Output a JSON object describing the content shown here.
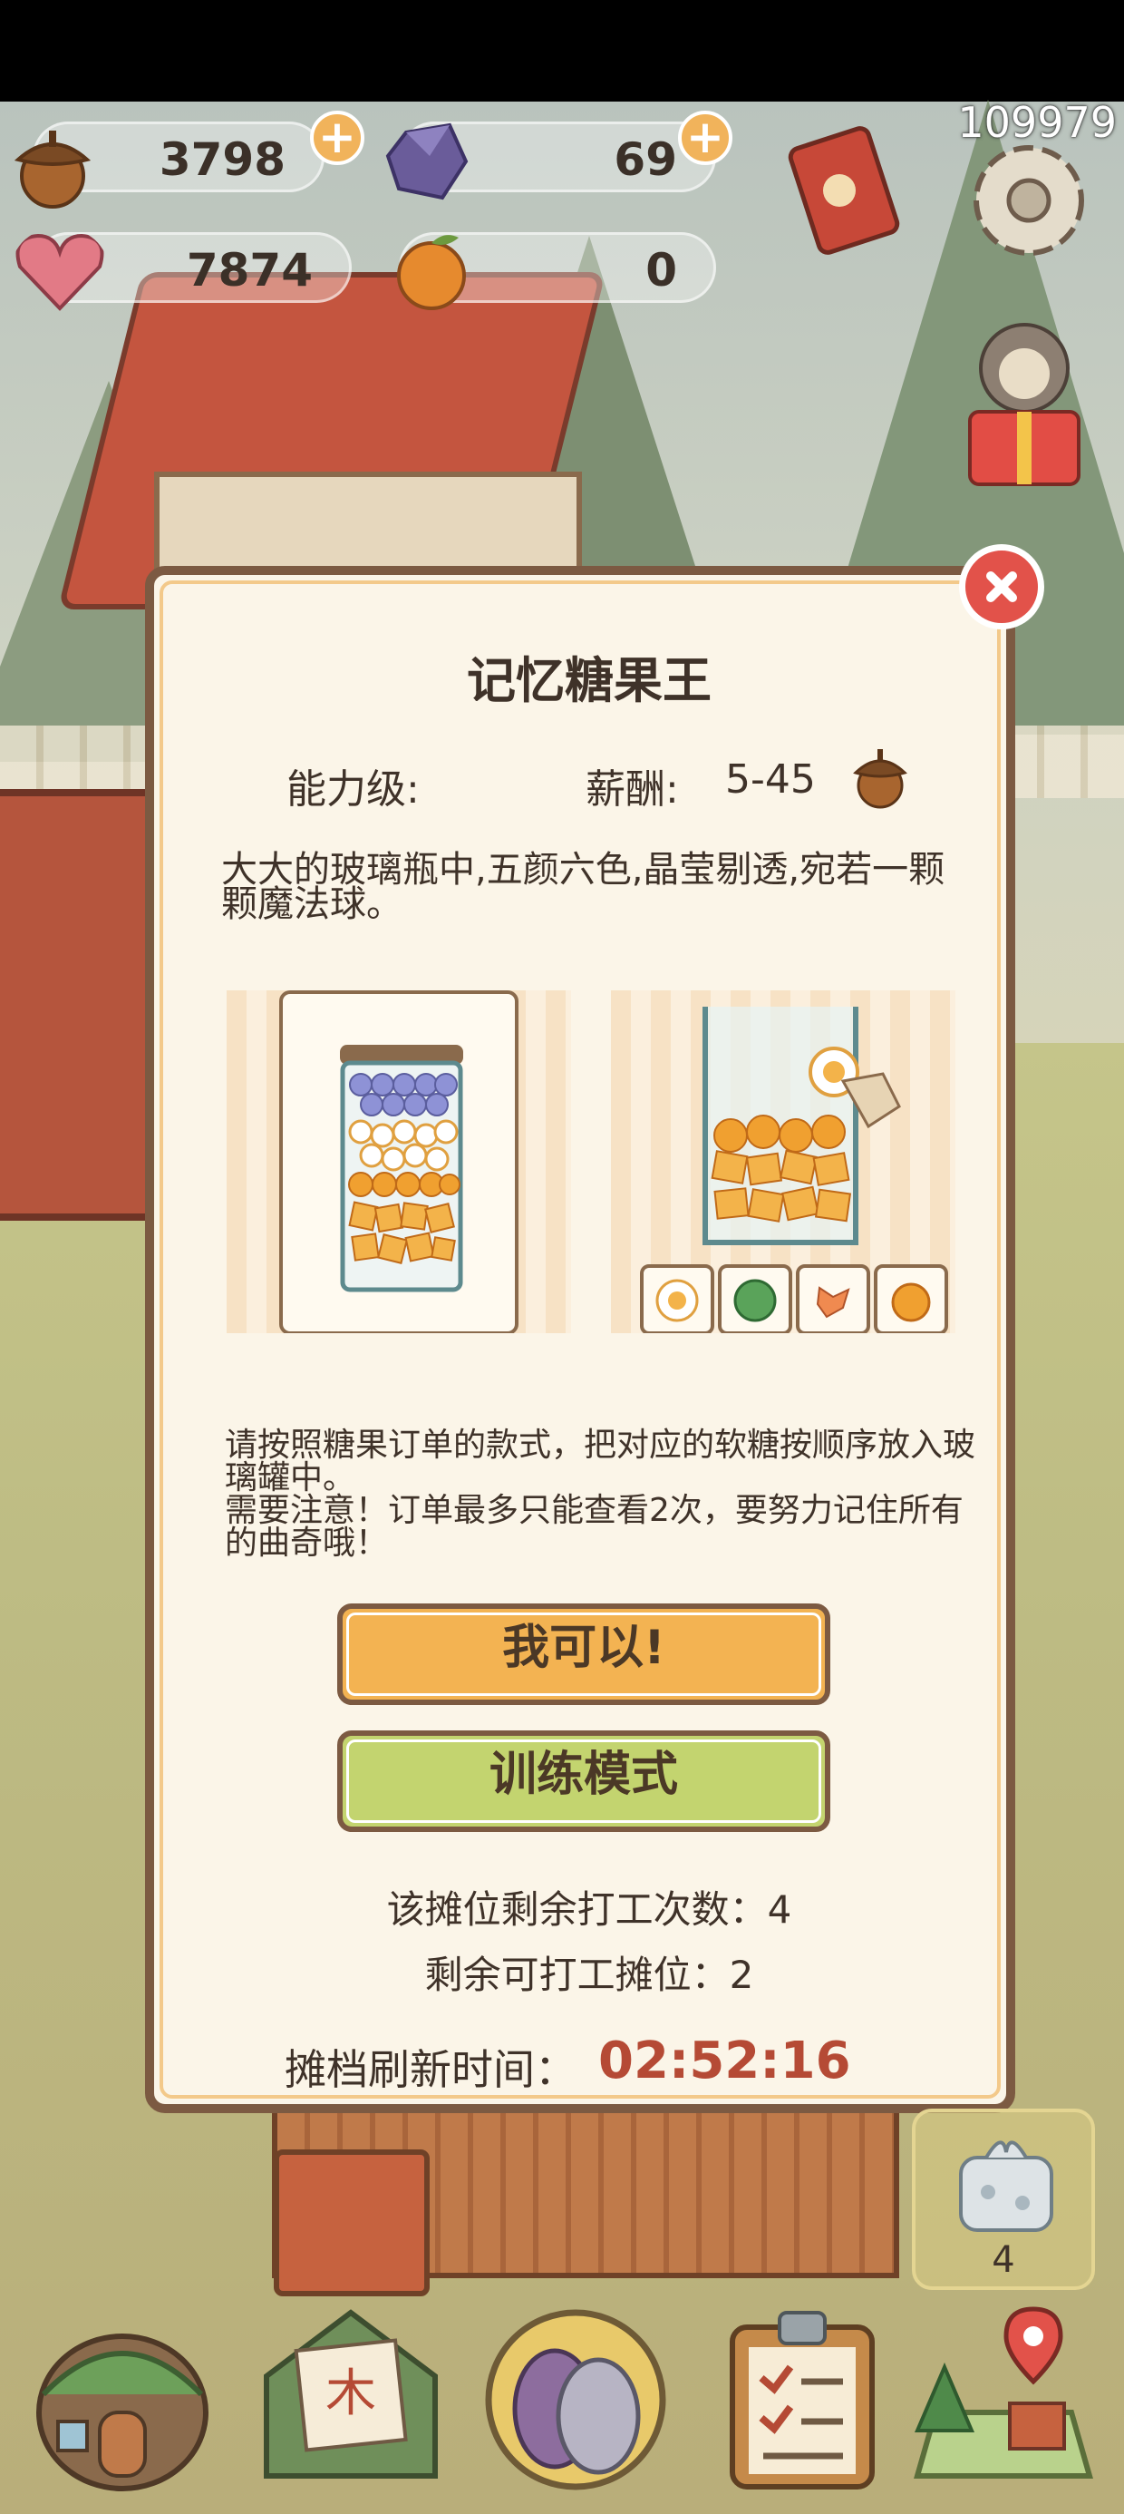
{
  "resources": {
    "acorns": "3798",
    "gems": "69",
    "hearts": "7874",
    "oranges": "0",
    "top_right_number": "109979"
  },
  "dialog": {
    "title": "记忆糖果王",
    "ability_label": "能力级:",
    "salary_label": "薪酬:",
    "salary_value": "5-45",
    "description": "大大的玻璃瓶中,五颜六色,晶莹剔透,宛若一颗颗魔法球。",
    "instruction_line1": "请按照糖果订单的款式，把对应的软糖按顺序放入玻璃罐中。",
    "instruction_line2": "需要注意！订单最多只能查看2次，要努力记住所有的曲奇哦！",
    "button_confirm": "我可以!",
    "button_training": "训练模式",
    "remaining_work_times": "该摊位剩余打工次数：4",
    "remaining_stalls": "剩余可打工摊位：2",
    "refresh_label": "摊档刷新时间：",
    "refresh_time": "02:52:16"
  },
  "gift_box_count": "4",
  "icons": {
    "acorn": "acorn-icon",
    "gem": "gem-icon",
    "heart": "heart-gem-icon",
    "orange": "orange-icon",
    "close": "close-icon",
    "settings": "gear-icon"
  },
  "colors": {
    "confirm_button": "#f3b352",
    "training_button": "#c3d46f",
    "refresh_time": "#b54a35",
    "dialog_bg": "#fbf5e8",
    "dialog_border": "#7c5a42"
  }
}
